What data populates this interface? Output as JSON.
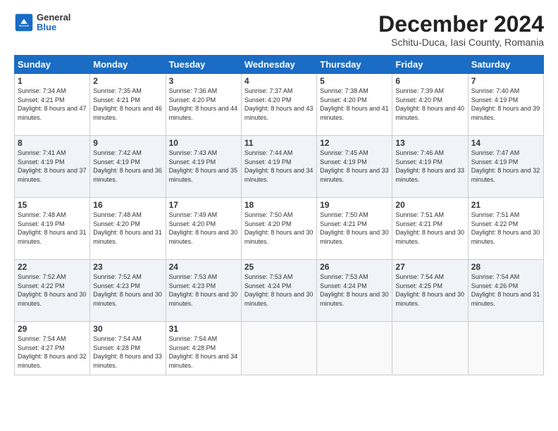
{
  "header": {
    "logo": {
      "general": "General",
      "blue": "Blue"
    },
    "title": "December 2024",
    "location": "Schitu-Duca, Iasi County, Romania"
  },
  "calendar": {
    "days": [
      "Sunday",
      "Monday",
      "Tuesday",
      "Wednesday",
      "Thursday",
      "Friday",
      "Saturday"
    ],
    "weeks": [
      [
        {
          "day": "1",
          "sunrise": "7:34 AM",
          "sunset": "4:21 PM",
          "daylight": "8 hours and 47 minutes."
        },
        {
          "day": "2",
          "sunrise": "7:35 AM",
          "sunset": "4:21 PM",
          "daylight": "8 hours and 46 minutes."
        },
        {
          "day": "3",
          "sunrise": "7:36 AM",
          "sunset": "4:20 PM",
          "daylight": "8 hours and 44 minutes."
        },
        {
          "day": "4",
          "sunrise": "7:37 AM",
          "sunset": "4:20 PM",
          "daylight": "8 hours and 43 minutes."
        },
        {
          "day": "5",
          "sunrise": "7:38 AM",
          "sunset": "4:20 PM",
          "daylight": "8 hours and 41 minutes."
        },
        {
          "day": "6",
          "sunrise": "7:39 AM",
          "sunset": "4:20 PM",
          "daylight": "8 hours and 40 minutes."
        },
        {
          "day": "7",
          "sunrise": "7:40 AM",
          "sunset": "4:19 PM",
          "daylight": "8 hours and 39 minutes."
        }
      ],
      [
        {
          "day": "8",
          "sunrise": "7:41 AM",
          "sunset": "4:19 PM",
          "daylight": "8 hours and 37 minutes."
        },
        {
          "day": "9",
          "sunrise": "7:42 AM",
          "sunset": "4:19 PM",
          "daylight": "8 hours and 36 minutes."
        },
        {
          "day": "10",
          "sunrise": "7:43 AM",
          "sunset": "4:19 PM",
          "daylight": "8 hours and 35 minutes."
        },
        {
          "day": "11",
          "sunrise": "7:44 AM",
          "sunset": "4:19 PM",
          "daylight": "8 hours and 34 minutes."
        },
        {
          "day": "12",
          "sunrise": "7:45 AM",
          "sunset": "4:19 PM",
          "daylight": "8 hours and 33 minutes."
        },
        {
          "day": "13",
          "sunrise": "7:46 AM",
          "sunset": "4:19 PM",
          "daylight": "8 hours and 33 minutes."
        },
        {
          "day": "14",
          "sunrise": "7:47 AM",
          "sunset": "4:19 PM",
          "daylight": "8 hours and 32 minutes."
        }
      ],
      [
        {
          "day": "15",
          "sunrise": "7:48 AM",
          "sunset": "4:19 PM",
          "daylight": "8 hours and 31 minutes."
        },
        {
          "day": "16",
          "sunrise": "7:48 AM",
          "sunset": "4:20 PM",
          "daylight": "8 hours and 31 minutes."
        },
        {
          "day": "17",
          "sunrise": "7:49 AM",
          "sunset": "4:20 PM",
          "daylight": "8 hours and 30 minutes."
        },
        {
          "day": "18",
          "sunrise": "7:50 AM",
          "sunset": "4:20 PM",
          "daylight": "8 hours and 30 minutes."
        },
        {
          "day": "19",
          "sunrise": "7:50 AM",
          "sunset": "4:21 PM",
          "daylight": "8 hours and 30 minutes."
        },
        {
          "day": "20",
          "sunrise": "7:51 AM",
          "sunset": "4:21 PM",
          "daylight": "8 hours and 30 minutes."
        },
        {
          "day": "21",
          "sunrise": "7:51 AM",
          "sunset": "4:22 PM",
          "daylight": "8 hours and 30 minutes."
        }
      ],
      [
        {
          "day": "22",
          "sunrise": "7:52 AM",
          "sunset": "4:22 PM",
          "daylight": "8 hours and 30 minutes."
        },
        {
          "day": "23",
          "sunrise": "7:52 AM",
          "sunset": "4:23 PM",
          "daylight": "8 hours and 30 minutes."
        },
        {
          "day": "24",
          "sunrise": "7:53 AM",
          "sunset": "4:23 PM",
          "daylight": "8 hours and 30 minutes."
        },
        {
          "day": "25",
          "sunrise": "7:53 AM",
          "sunset": "4:24 PM",
          "daylight": "8 hours and 30 minutes."
        },
        {
          "day": "26",
          "sunrise": "7:53 AM",
          "sunset": "4:24 PM",
          "daylight": "8 hours and 30 minutes."
        },
        {
          "day": "27",
          "sunrise": "7:54 AM",
          "sunset": "4:25 PM",
          "daylight": "8 hours and 30 minutes."
        },
        {
          "day": "28",
          "sunrise": "7:54 AM",
          "sunset": "4:26 PM",
          "daylight": "8 hours and 31 minutes."
        }
      ],
      [
        {
          "day": "29",
          "sunrise": "7:54 AM",
          "sunset": "4:27 PM",
          "daylight": "8 hours and 32 minutes."
        },
        {
          "day": "30",
          "sunrise": "7:54 AM",
          "sunset": "4:28 PM",
          "daylight": "8 hours and 33 minutes."
        },
        {
          "day": "31",
          "sunrise": "7:54 AM",
          "sunset": "4:28 PM",
          "daylight": "8 hours and 34 minutes."
        },
        null,
        null,
        null,
        null
      ]
    ]
  }
}
